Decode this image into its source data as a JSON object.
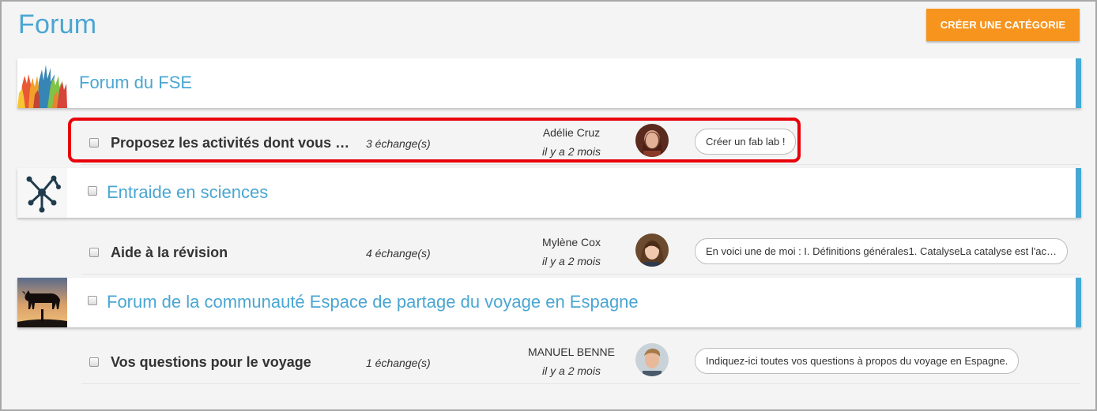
{
  "page": {
    "title": "Forum",
    "create_button_label": "CRÉER UNE CATÉGORIE"
  },
  "colors": {
    "accent_blue": "#45a9d6",
    "title_blue": "#4aa6d2",
    "create_button": "#f7941d",
    "highlight_red": "#e8000a"
  },
  "categories": [
    {
      "title": "Forum du FSE",
      "image": "raised-hands-image",
      "topics": [
        {
          "title": "Proposez les activités dont vous a…",
          "count": "3 échange(s)",
          "author": "Adélie Cruz",
          "date": "il y a 2 mois",
          "avatar": "avatar-adelie",
          "last_message": "Créer un fab lab !"
        }
      ]
    },
    {
      "title": "Entraide en sciences",
      "image": "molecule-icon",
      "topics": [
        {
          "title": "Aide à la révision",
          "count": "4 échange(s)",
          "author": "Mylène Cox",
          "date": "il y a 2 mois",
          "avatar": "avatar-mylene",
          "last_message": "En voici une de moi : I. Définitions générales1. CatalyseLa catalyse est l'ac…"
        }
      ]
    },
    {
      "title": "Forum de la communauté Espace de partage du voyage en Espagne",
      "image": "bull-sunset-image",
      "topics": [
        {
          "title": "Vos questions pour le voyage",
          "count": "1 échange(s)",
          "author": "MANUEL BENNE",
          "date": "il y a 2 mois",
          "avatar": "avatar-manuel",
          "last_message": "Indiquez-ici toutes vos questions à propos du voyage en Espagne."
        }
      ]
    }
  ]
}
